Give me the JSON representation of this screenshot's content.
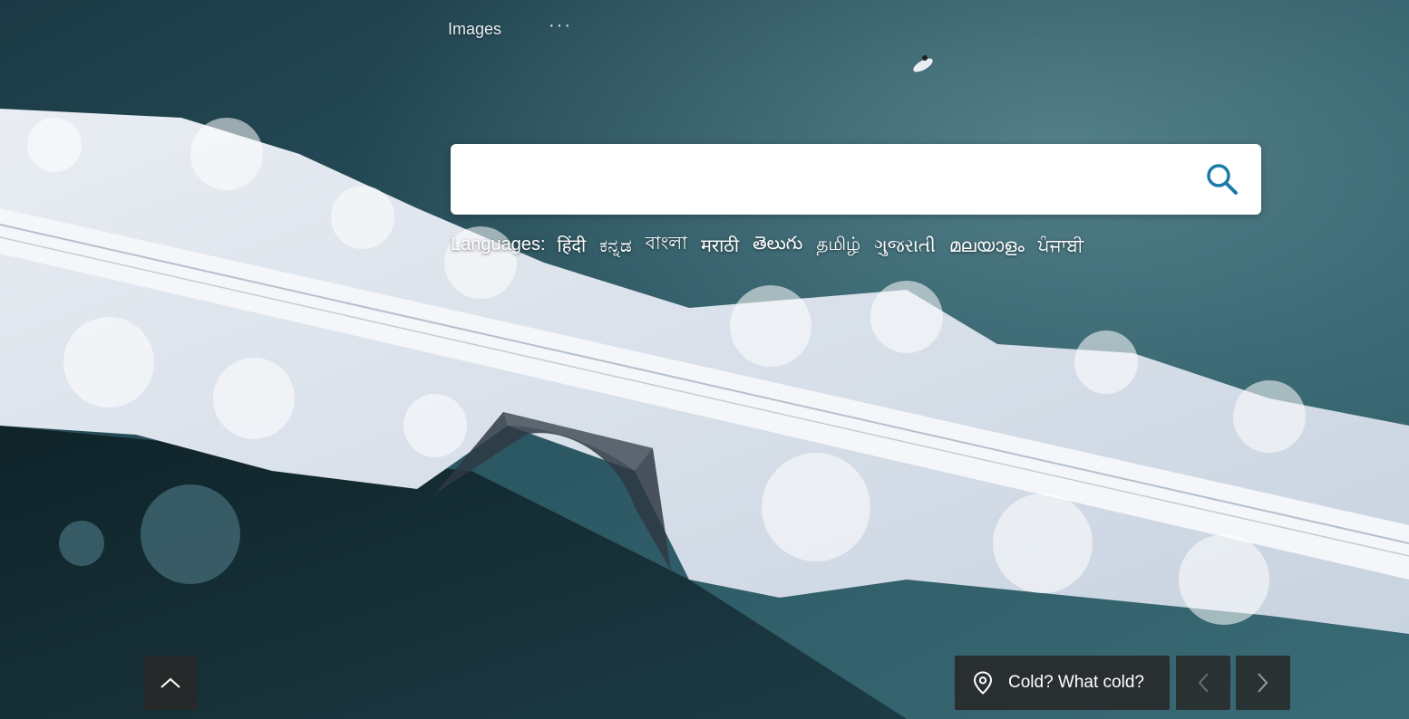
{
  "nav": {
    "images_label": "Images",
    "more_label": "···"
  },
  "search": {
    "placeholder": "",
    "value": ""
  },
  "languages": {
    "label": "Languages:",
    "items": [
      "हिंदी",
      "ಕನ್ನಡ",
      "বাংলা",
      "मराठी",
      "తెలుగు",
      "தமிழ்",
      "ગુજરાતી",
      "മലയാളം",
      "ਪੰਜਾਬੀ"
    ]
  },
  "image_caption": {
    "text": "Cold? What cold?",
    "icon": "location-pin-icon"
  },
  "controls": {
    "scroll_up_icon": "chevron-up-icon",
    "prev_icon": "chevron-left-icon",
    "next_icon": "chevron-right-icon"
  },
  "colors": {
    "search_icon": "#1a7ba8",
    "panel_bg": "#282828"
  }
}
